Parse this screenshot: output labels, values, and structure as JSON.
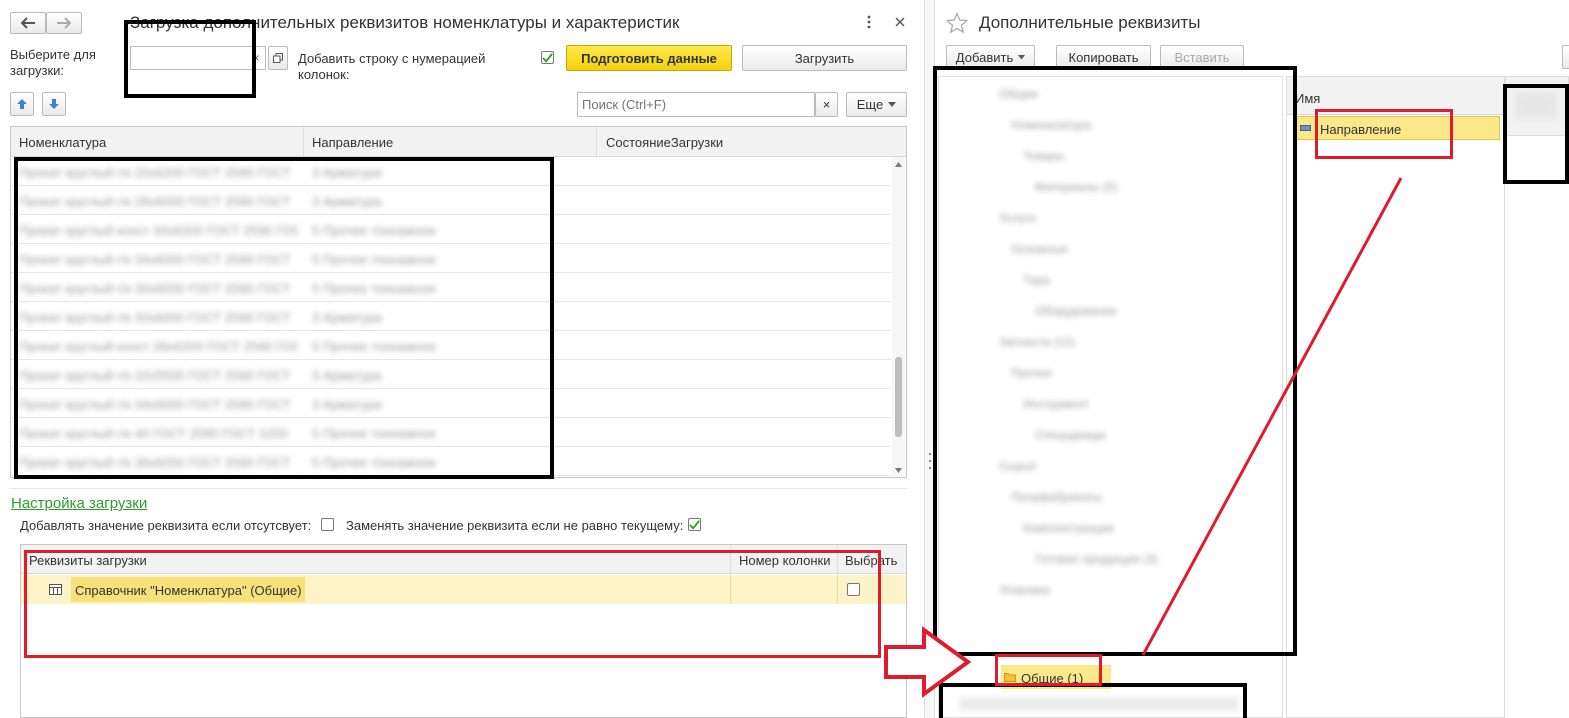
{
  "left": {
    "title": "Загрузка дополнительных реквизитов номенклатуры и характеристик",
    "select_label": "Выберите для загрузки:",
    "file_value": "",
    "add_row_label": "Добавить строку с нумерацией колонок:",
    "add_row_checked": true,
    "prepare_button": "Подготовить данные",
    "load_button": "Загрузить",
    "search_placeholder": "Поиск (Ctrl+F)",
    "more_button": "Еще",
    "table": {
      "columns": [
        "Номенклатура",
        "Направление",
        "СостояниеЗагрузки"
      ],
      "rows": [
        [
          "Прокат круглый г/к 20х6200 ГОСТ 2590 ГОСТ",
          "3 Арматура",
          ""
        ],
        [
          "Прокат круглый г/к 28х6000 ГОСТ 2590 ГОСТ",
          "3 Арматура",
          ""
        ],
        [
          "Прокат круглый конст 34х6200 ГОСТ 2590 ГОСТ",
          "5 Прочее тоннажное",
          ""
        ],
        [
          "Прокат круглый г/к 34х6000 ГОСТ 2590 ГОСТ",
          "5 Прочее тоннажное",
          ""
        ],
        [
          "Прокат круглый г/к 30х6000 ГОСТ 2590 ГОСТ",
          "5 Прочее тоннажное",
          ""
        ],
        [
          "Прокат круглый г/к 32х6000 ГОСТ 2590 ГОСТ",
          "3 Арматура",
          ""
        ],
        [
          "Прокат круглый конст 28х6200 ГОСТ 2590 ГОСТ",
          "5 Прочее тоннажное",
          ""
        ],
        [
          "Прокат круглый г/к 22х5500 ГОСТ 2590 ГОСТ",
          "3 Арматура",
          ""
        ],
        [
          "Прокат круглый г/к 34х6000 ГОСТ 2590 ГОСТ",
          "3 Арматура",
          ""
        ],
        [
          "Прокат круглый г/к 40 ГОСТ 2590 ГОСТ 1050",
          "5 Прочее тоннажное",
          ""
        ],
        [
          "Прокат круглый г/к 36х6000 ГОСТ 2590 ГОСТ",
          "5 Прочее тоннажное",
          ""
        ]
      ]
    },
    "settings": {
      "link": "Настройка загрузки",
      "add_if_missing_label": "Добавлять значение реквизита если отсутсвует:",
      "add_if_missing_checked": false,
      "replace_label": "Заменять значение реквизита если не равно текущему:",
      "replace_checked": true
    },
    "attrs_table": {
      "columns": [
        "Реквизиты загрузки",
        "Номер колонки",
        "Выбрать"
      ],
      "rows": [
        {
          "name": "Справочник \"Номенклатура\" (Общие)",
          "col": "",
          "checked": false
        }
      ]
    }
  },
  "right": {
    "title": "Дополнительные реквизиты",
    "add_button": "Добавить",
    "copy_button": "Копировать",
    "paste_button": "Вставить",
    "name_column": "Имя",
    "selected_item": "Направление",
    "tree_items": [
      "Общие",
      "Номенклатура",
      "Товары",
      "Материалы (5)",
      "Услуги",
      "Основные",
      "Тара",
      "Оборудование",
      "Запчасти (12)",
      "Прочее",
      "Инструмент",
      "Спецодежда",
      "Сырьё",
      "Полуфабрикаты",
      "Комплектующие",
      "Готовая продукция (3)",
      "Упаковка"
    ],
    "group_item": "Общие (1)"
  },
  "colors": {
    "accent_yellow": "#f5d614",
    "row_highlight": "#fbf0b6",
    "annot_red": "#e01b2b",
    "link_green": "#2f9b2f",
    "arrow_blue": "#3b7fd8"
  }
}
